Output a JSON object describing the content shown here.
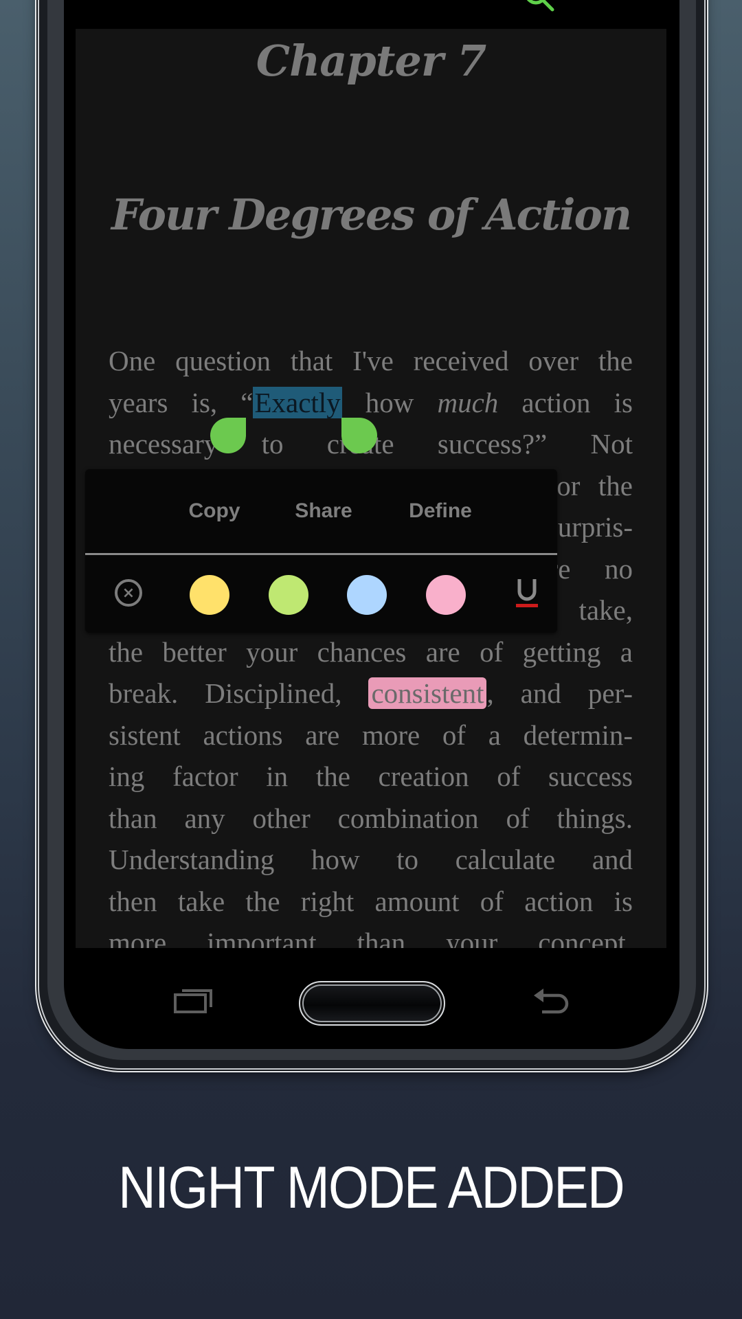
{
  "reader": {
    "chapter_label": "Chapter 7",
    "chapter_title": "Four Degrees of Action",
    "paragraph_lines": [
      {
        "pre": "One question that I've received over the"
      },
      {
        "pre": "years is, “",
        "selected": "Exactly",
        "post_plain": " how ",
        "italic": "much",
        "post": " action is"
      },
      {
        "pre": "necessary to create success?” Not"
      },
      {
        "pre": "surprisingly, the answer is simple for the"
      },
      {
        "pre": "most part, the answer will seem surpris-"
      },
      {
        "pre": "ing. More is better. There are no"
      },
      {
        "pre": "limits. The more action you take,"
      },
      {
        "pre": "the better your chances are of getting a"
      },
      {
        "pre": "break. Disciplined, ",
        "highlighted": "consistent",
        "post": ", and per-"
      },
      {
        "pre": "sistent actions are more of a determin-"
      },
      {
        "pre": "ing factor in the creation of success"
      },
      {
        "pre": "than any other combination of things."
      },
      {
        "pre": "Understanding how to calculate and"
      },
      {
        "pre": "then take the right amount of action is"
      },
      {
        "pre": "more important than your concept."
      }
    ],
    "selected_word": "Exactly",
    "highlighted_word": "consistent",
    "selection_color": "#1f5b78",
    "handle_color": "#6cc94f"
  },
  "selection_popup": {
    "actions": [
      {
        "label": "Copy"
      },
      {
        "label": "Share"
      },
      {
        "label": "Define"
      }
    ],
    "highlight_colors": [
      {
        "name": "yellow",
        "color": "#ffe16b"
      },
      {
        "name": "green",
        "color": "#bfe872"
      },
      {
        "name": "blue",
        "color": "#aed6ff"
      },
      {
        "name": "pink",
        "color": "#f9b0cb"
      }
    ],
    "underline_label": "U",
    "underline_color": "#cc1b1b",
    "remove_label": "×"
  },
  "top_bar": {
    "icon": "search-icon",
    "icon_color": "#5fd04a"
  },
  "navbar": {
    "recents_icon": "recents-icon",
    "home_button": "home-button",
    "back_icon": "back-icon"
  },
  "promo": {
    "tagline": "NIGHT MODE ADDED"
  }
}
